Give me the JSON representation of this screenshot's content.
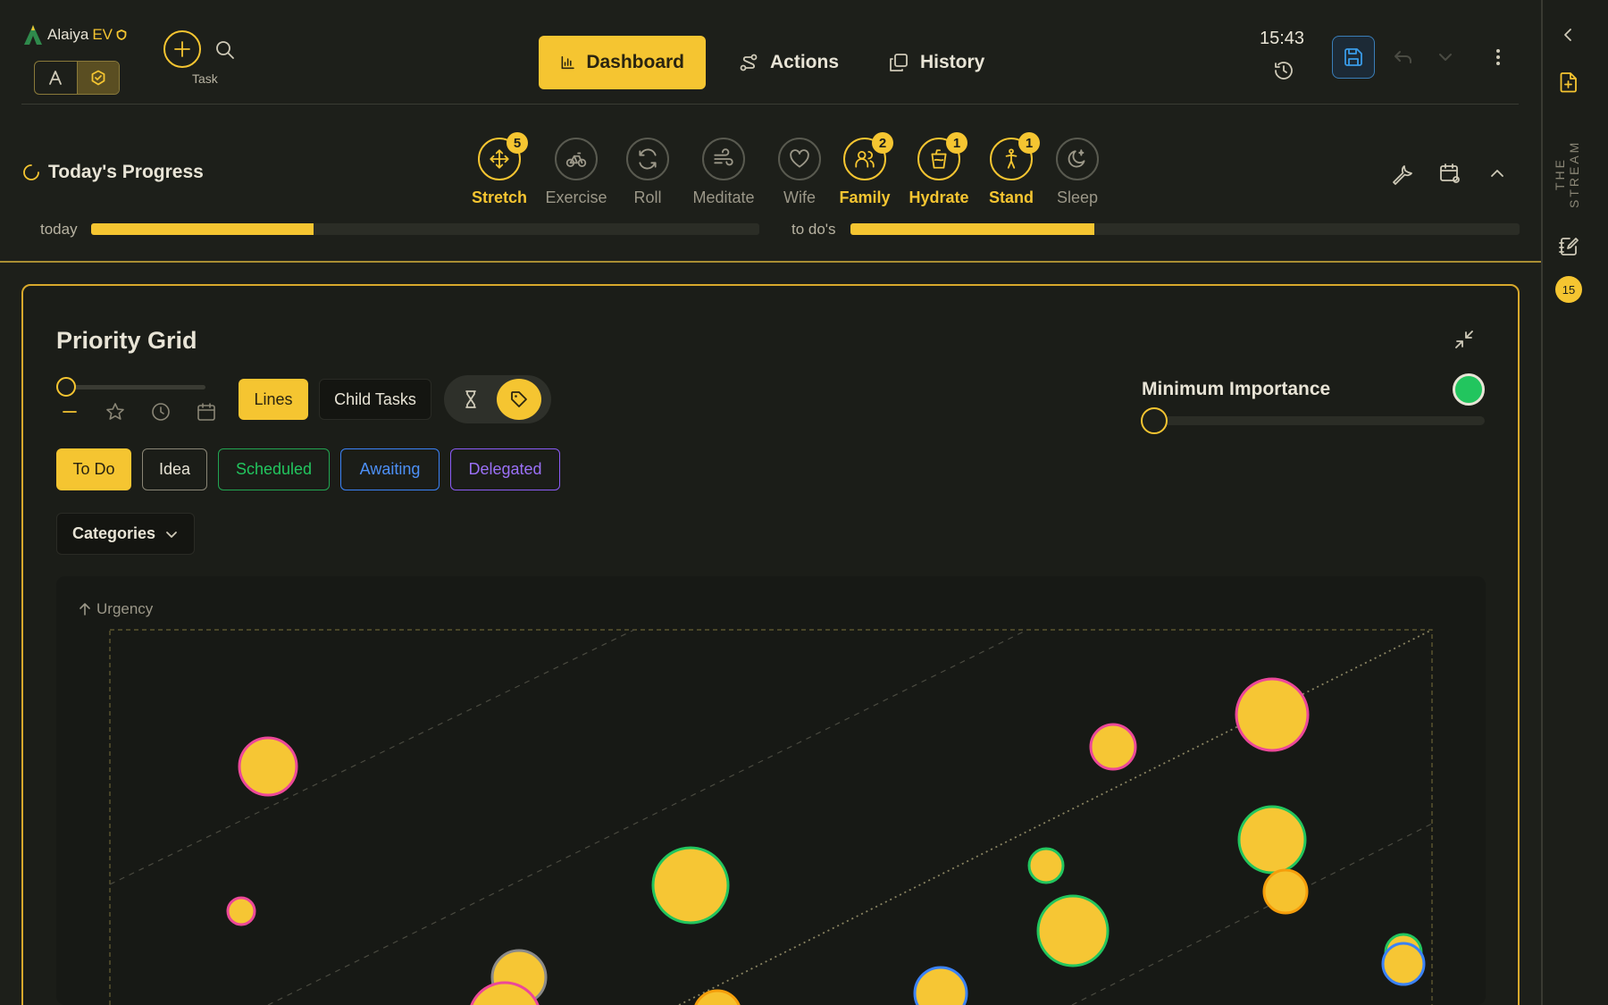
{
  "app": {
    "logo_name": "Alaiya",
    "logo_suffix": "EV"
  },
  "header": {
    "task_label": "Task",
    "nav": [
      {
        "label": "Dashboard",
        "icon": "bar-chart-icon",
        "active": true
      },
      {
        "label": "Actions",
        "icon": "route-icon",
        "active": false
      },
      {
        "label": "History",
        "icon": "copy-icon",
        "active": false
      }
    ],
    "time": "15:43"
  },
  "progress": {
    "title": "Today's Progress",
    "habits": [
      {
        "label": "Stretch",
        "icon": "move-icon",
        "active": true,
        "badge": "5"
      },
      {
        "label": "Exercise",
        "icon": "bike-icon",
        "active": false,
        "badge": ""
      },
      {
        "label": "Roll",
        "icon": "refresh-icon",
        "active": false,
        "badge": ""
      },
      {
        "label": "Meditate",
        "icon": "wind-icon",
        "active": false,
        "badge": ""
      },
      {
        "label": "Wife",
        "icon": "heart-icon",
        "active": false,
        "badge": ""
      },
      {
        "label": "Family",
        "icon": "users-icon",
        "active": true,
        "badge": "2"
      },
      {
        "label": "Hydrate",
        "icon": "cup-icon",
        "active": true,
        "badge": "1"
      },
      {
        "label": "Stand",
        "icon": "person-standing-icon",
        "active": true,
        "badge": "1"
      },
      {
        "label": "Sleep",
        "icon": "moon-icon",
        "active": false,
        "badge": ""
      }
    ],
    "today_label": "today",
    "today_fraction": 0.333,
    "todos_label": "to do's",
    "todos_fraction": 0.365
  },
  "sidebar": {
    "title": "THE STREAM",
    "badge": "15"
  },
  "priority_grid": {
    "title": "Priority Grid",
    "lines_label": "Lines",
    "child_tasks_label": "Child Tasks",
    "min_importance_label": "Minimum Importance",
    "filters": [
      "To Do",
      "Idea",
      "Scheduled",
      "Awaiting",
      "Delegated"
    ],
    "categories_label": "Categories",
    "y_axis_label": "Urgency",
    "colors": {
      "accent": "#f5c531",
      "pink": "#ec4899",
      "green": "#22c55e",
      "blue": "#3b82f6",
      "orange": "#f59e0b",
      "gray": "#8a8a8a"
    }
  }
}
